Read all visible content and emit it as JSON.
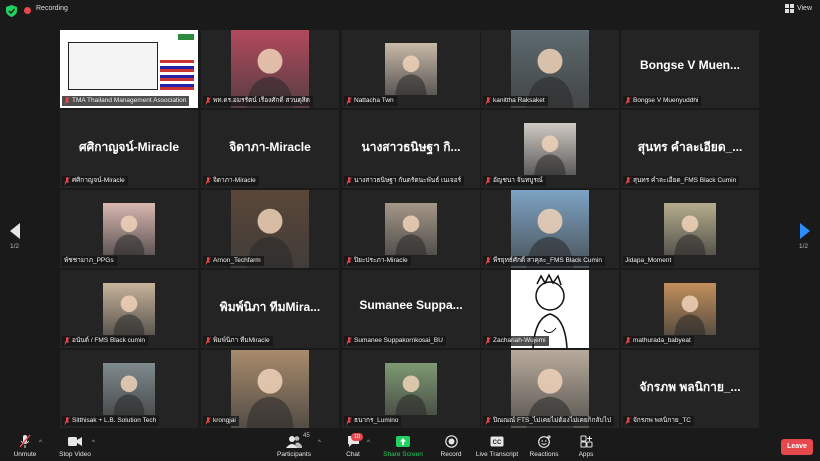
{
  "topbar": {
    "recording_label": "Recording",
    "view_label": "View"
  },
  "pagination": {
    "left_label": "1/2",
    "right_label": "1/2"
  },
  "tiles": [
    {
      "label": "TMA Thailand Management Association",
      "big": "",
      "muted": true,
      "active": true,
      "video": "slide"
    },
    {
      "label": "พท.ดร.อมรรัตน์ เรืองศักดิ์ สวนดุสิต",
      "big": "",
      "muted": true,
      "video": "person1"
    },
    {
      "label": "Nattacha Twn",
      "big": "",
      "muted": true,
      "video": "person2"
    },
    {
      "label": "kanittha Raksaket",
      "big": "",
      "muted": true,
      "video": "person3"
    },
    {
      "label": "Bongse V Muenyuddhi",
      "big": "Bongse V Muen...",
      "muted": true,
      "video": ""
    },
    {
      "label": "ศศิกาญจน์-Miracle",
      "big": "ศศิกาญจน์-Miracle",
      "muted": true,
      "video": ""
    },
    {
      "label": "จิดาภา-Miracle",
      "big": "จิดาภา-Miracle",
      "muted": true,
      "video": ""
    },
    {
      "label": "นางสาวธนิษฐา กันตรัตนะพันธ์ เนเจอร์",
      "big": "นางสาวธนิษฐา กิ...",
      "muted": true,
      "video": ""
    },
    {
      "label": "อัญชนา จันทบูรณ์",
      "big": "",
      "muted": true,
      "video": "person4"
    },
    {
      "label": "สุนทร คำละเอียด_FMS Black Cumin",
      "big": "สุนทร คำละเอียด_...",
      "muted": true,
      "video": ""
    },
    {
      "label": "พัชชามาภ_PPGs",
      "big": "",
      "muted": false,
      "video": "person5"
    },
    {
      "label": "Arnon_Techfarm",
      "big": "",
      "muted": true,
      "video": "person6"
    },
    {
      "label": "ปิยะประภา-Miracle",
      "big": "",
      "muted": true,
      "video": "person7"
    },
    {
      "label": "พีรยุทธ์ศักดิ์ สาคุละ_FMS Black Cumin",
      "big": "",
      "muted": true,
      "video": "person8"
    },
    {
      "label": "Jidapa_Moment",
      "big": "",
      "muted": false,
      "video": "person9"
    },
    {
      "label": "อนันต์ / FMS Black cumin",
      "big": "",
      "muted": true,
      "video": "person10"
    },
    {
      "label": "พิมพ์นิภา ทีมMiracle",
      "big": "พิมพ์นิภา ทีมMira...",
      "muted": true,
      "video": ""
    },
    {
      "label": "Sumanee Suppakornkosai_BU",
      "big": "Sumanee Suppa...",
      "muted": true,
      "video": ""
    },
    {
      "label": "Zachariah-Wujemi",
      "big": "",
      "muted": true,
      "video": "cartoon"
    },
    {
      "label": "mathurada_babyeat",
      "big": "",
      "muted": true,
      "video": "dog"
    },
    {
      "label": "Sitthisak + L.B. Solution Tech",
      "big": "",
      "muted": true,
      "video": "person11"
    },
    {
      "label": "krongjai",
      "big": "",
      "muted": true,
      "video": "cat"
    },
    {
      "label": "ธนากร_Lumino",
      "big": "",
      "muted": true,
      "video": "person12"
    },
    {
      "label": "ปิณณณ์ FTS_ไม่เคยไม่ต้องไม่เคยก็กลับไป",
      "big": "",
      "muted": true,
      "video": "person13"
    },
    {
      "label": "จักรภพ พลนิกาย_TC",
      "big": "จักรภพ พลนิกาย_...",
      "muted": true,
      "video": ""
    }
  ],
  "toolbar": {
    "unmute": "Unmute",
    "stop_video": "Stop Video",
    "participants": "Participants",
    "participants_count": "45",
    "chat": "Chat",
    "chat_badge": "10",
    "share_screen": "Share Screen",
    "record": "Record",
    "live_transcript": "Live Transcript",
    "reactions": "Reactions",
    "apps": "Apps",
    "leave": "Leave"
  },
  "colors": {
    "active_speaker": "#f0e24a",
    "leave": "#e5484d",
    "share": "#23d160",
    "muted_mic": "#e5484d"
  }
}
